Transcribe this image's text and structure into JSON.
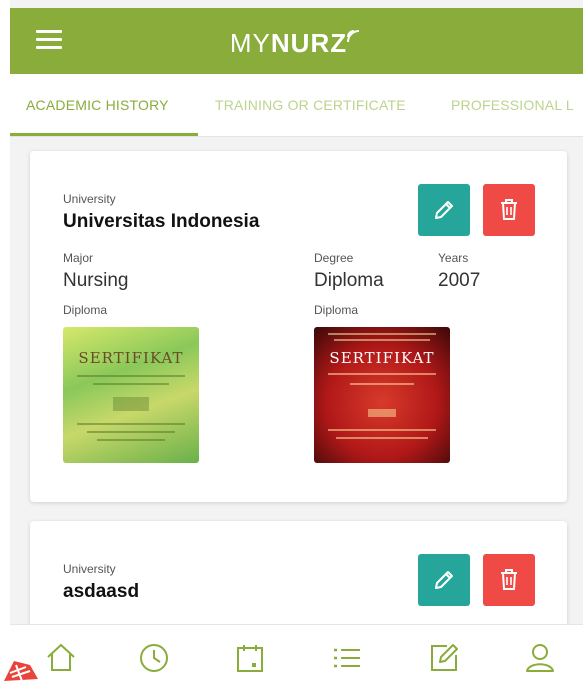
{
  "app": {
    "brand_light": "MY",
    "brand_bold": "NURZ",
    "accent_color": "#8aac3b",
    "edit_color": "#26a69a",
    "delete_color": "#ef4a45"
  },
  "tabs": [
    {
      "label": "ACADEMIC HISTORY",
      "active": true
    },
    {
      "label": "TRAINING OR CERTIFICATE",
      "active": false
    },
    {
      "label": "PROFESSIONAL L",
      "active": false
    }
  ],
  "records": [
    {
      "university_label": "University",
      "university": "Universitas Indonesia",
      "major_label": "Major",
      "major": "Nursing",
      "degree_label": "Degree",
      "degree": "Diploma",
      "years_label": "Years",
      "years": "2007",
      "diploma_label_1": "Diploma",
      "diploma_label_2": "Diploma",
      "cert_text_1": "SERTIFIKAT",
      "cert_text_2": "SERTIFIKAT"
    },
    {
      "university_label": "University",
      "university": "asdaasd"
    }
  ],
  "icons": {
    "menu": "hamburger-icon",
    "edit": "pencil-icon",
    "delete": "trash-icon",
    "nav": [
      "home-icon",
      "clock-icon",
      "calendar-icon",
      "list-icon",
      "edit-note-icon",
      "user-icon"
    ]
  }
}
